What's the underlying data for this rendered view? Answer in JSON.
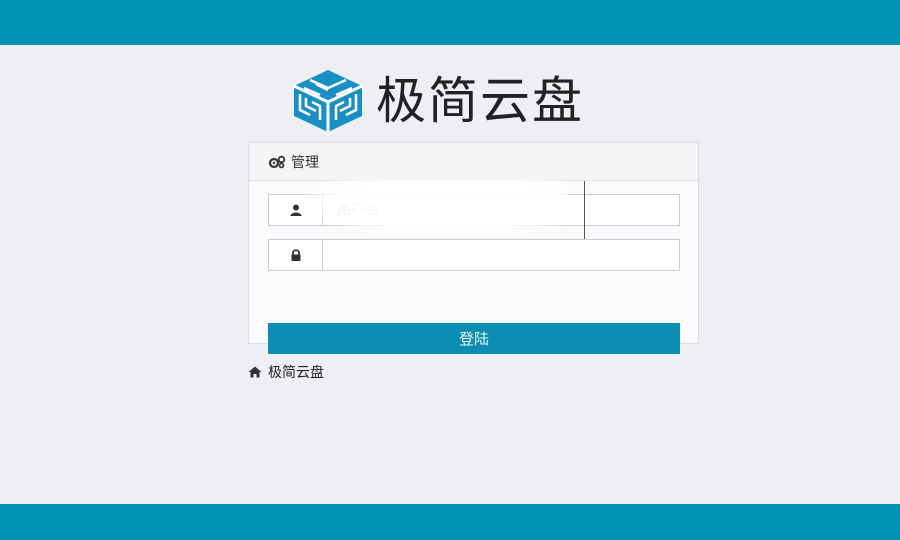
{
  "brand": {
    "name": "极简云盘",
    "logo_icon": "cube-maze-icon",
    "color": "#1a8fc4"
  },
  "panel": {
    "title": "管理",
    "title_icon": "gears-icon"
  },
  "form": {
    "username": {
      "placeholder": "用户名",
      "value": "",
      "icon": "user-icon"
    },
    "password": {
      "placeholder": "",
      "value": "",
      "icon": "lock-icon"
    },
    "login_label": "登陆"
  },
  "footer_link": {
    "label": "极简云盘",
    "icon": "home-icon"
  },
  "colors": {
    "bar": "#0191b5",
    "button": "#0a8db2",
    "background": "#edeff4"
  }
}
